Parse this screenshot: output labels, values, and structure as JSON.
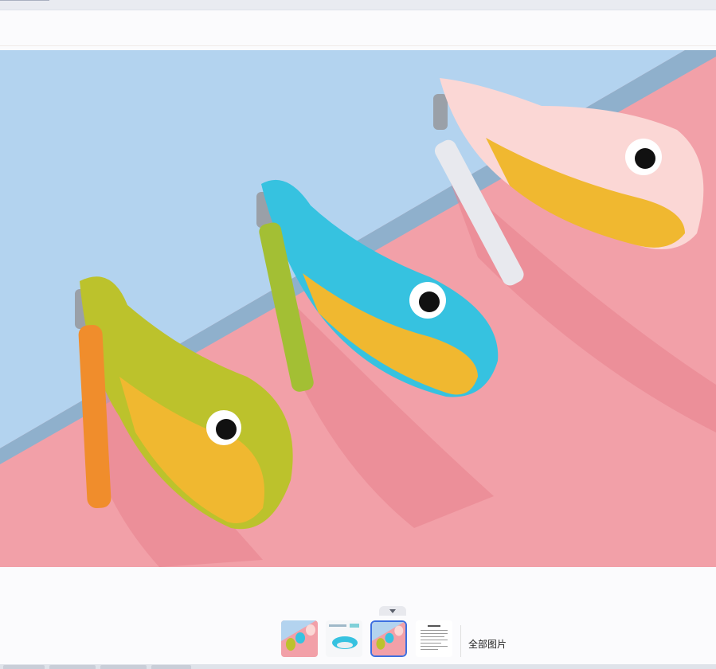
{
  "thumbnails": {
    "collapse_icon": "chevron-down-icon",
    "items": [
      {
        "name": "photo-1",
        "selected": false
      },
      {
        "name": "photo-2",
        "selected": false
      },
      {
        "name": "photo-3",
        "selected": true
      },
      {
        "name": "photo-4",
        "selected": false
      }
    ],
    "all_images_label": "全部图片"
  },
  "colors": {
    "selection_border": "#3c6fe0",
    "background": "#fbfbfd"
  }
}
